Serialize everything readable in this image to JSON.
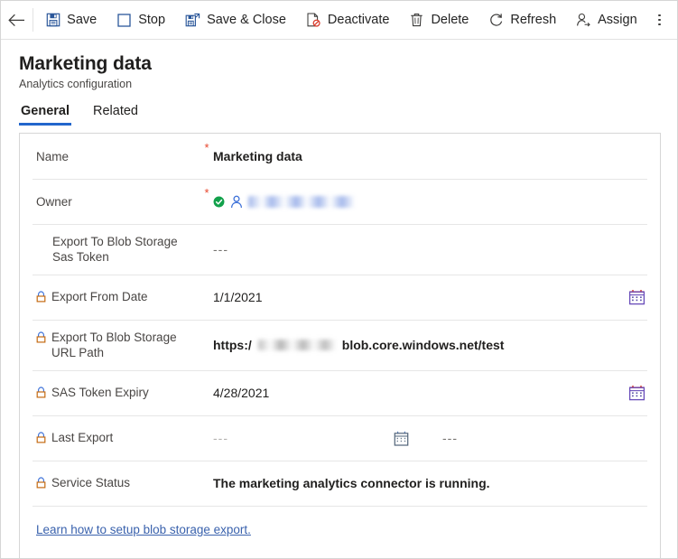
{
  "window": {
    "back_label": "Back"
  },
  "commandbar": {
    "buttons": [
      {
        "label": "Save",
        "icon": "save-icon"
      },
      {
        "label": "Stop",
        "icon": "stop-icon"
      },
      {
        "label": "Save & Close",
        "icon": "save-and-close-icon"
      },
      {
        "label": "Deactivate",
        "icon": "deactivate-icon"
      },
      {
        "label": "Delete",
        "icon": "delete-icon"
      },
      {
        "label": "Refresh",
        "icon": "refresh-icon"
      },
      {
        "label": "Assign",
        "icon": "assign-icon"
      }
    ],
    "overflow_label": "More commands"
  },
  "header": {
    "title": "Marketing data",
    "subtitle": "Analytics configuration"
  },
  "tabs": [
    {
      "label": "General",
      "active": true
    },
    {
      "label": "Related",
      "active": false
    }
  ],
  "form": {
    "rows": [
      {
        "key": "name",
        "label": "Name",
        "required": true,
        "locked": false,
        "value": "Marketing data",
        "value_style": "strong"
      },
      {
        "key": "owner",
        "label": "Owner",
        "required": true,
        "locked": false,
        "value": "",
        "redacted": true,
        "badges": [
          "verified-check-icon",
          "person-icon"
        ]
      },
      {
        "key": "export_to_blob_storage_sas_token",
        "label": "Export To Blob Storage Sas Token",
        "required": false,
        "locked": false,
        "value": "---"
      },
      {
        "key": "export_from_date",
        "label": "Export From Date",
        "required": false,
        "locked": true,
        "value": "1/1/2021",
        "calendar": true
      },
      {
        "key": "export_to_blob_storage_url_path",
        "label": "Export To Blob Storage URL Path",
        "required": false,
        "locked": true,
        "value_prefix": "https:/",
        "value_suffix": "blob.core.windows.net/test",
        "redacted": true,
        "value_style": "strong"
      },
      {
        "key": "sas_token_expiry",
        "label": "SAS Token Expiry",
        "required": false,
        "locked": true,
        "value": "4/28/2021",
        "calendar": true
      },
      {
        "key": "last_export",
        "label": "Last Export",
        "required": false,
        "locked": true,
        "value": "---",
        "value_secondary": "---",
        "calendar_inline": true
      },
      {
        "key": "service_status",
        "label": "Service Status",
        "required": false,
        "locked": true,
        "value": "The marketing analytics connector is running.",
        "value_style": "strong"
      }
    ],
    "footer_link": "Learn how to setup blob storage export."
  },
  "colors": {
    "accent": "#2266cc",
    "required_asterisk": "#e8452c",
    "link": "#3a62ad",
    "icon_blue": "#2b579a",
    "verified_green": "#0f9d58",
    "lock_body": "#c46a11",
    "calendar_red": "#d63d2e",
    "calendar_purple": "#6b4fbb",
    "text_primary": "#201f1e",
    "text_secondary": "#494644"
  }
}
